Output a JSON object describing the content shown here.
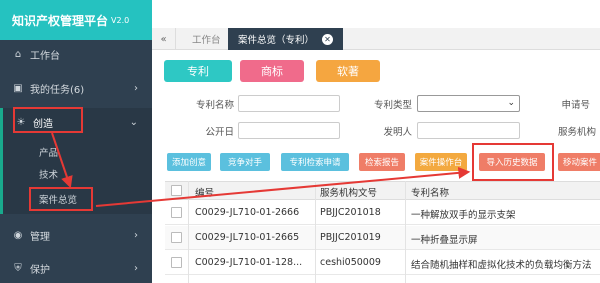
{
  "brand": {
    "title": "知识产权管理平台",
    "version": "V2.0"
  },
  "sidebar": {
    "items": [
      {
        "label": "工作台",
        "icon": "home-icon"
      },
      {
        "label": "我的任务(6)",
        "icon": "task-icon"
      },
      {
        "label": "创造",
        "icon": "bulb-icon"
      },
      {
        "label": "管理",
        "icon": "database-icon"
      },
      {
        "label": "保护",
        "icon": "shield-icon"
      }
    ],
    "sub_items": [
      "产品",
      "技术",
      "案件总览"
    ]
  },
  "tabbar": {
    "tabs": [
      "工作台",
      "案件总览（专利）"
    ]
  },
  "categories": [
    "专利",
    "商标",
    "软著"
  ],
  "form": {
    "labels": [
      "专利名称",
      "专利类型",
      "申请号",
      "公开日",
      "发明人",
      "服务机构"
    ]
  },
  "actions": [
    "添加创意",
    "竞争对手",
    "专利检索申请",
    "检索报告",
    "案件操作台",
    "导入历史数据",
    "移动案件"
  ],
  "table": {
    "columns": [
      "编号",
      "服务机构文号",
      "专利名称"
    ],
    "rows": [
      [
        "C0029-JL710-01-2666",
        "PBJJC201018",
        "一种解放双手的显示支架"
      ],
      [
        "C0029-JL710-01-2665",
        "PBJJC201019",
        "一种折叠显示屏"
      ],
      [
        "C0029-JL710-01-128...",
        "ceshi050009",
        "结合随机抽样和虚拟化技术的负载均衡方法"
      ]
    ]
  },
  "colors": {
    "sidebar": "#2f4050",
    "brand": "#25c2c0",
    "accent": "#19aa8d",
    "annotation": "#e53935"
  }
}
